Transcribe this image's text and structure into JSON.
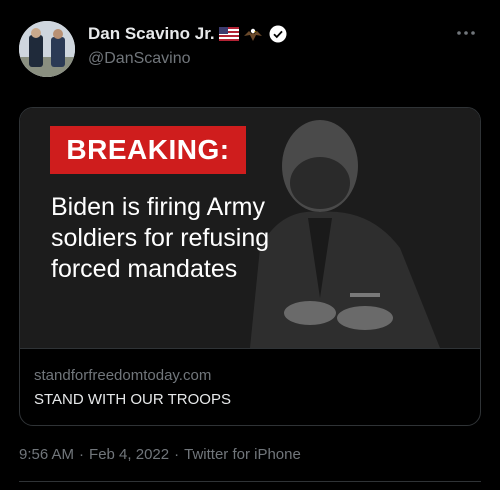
{
  "tweet": {
    "author": {
      "display_name": "Dan Scavino Jr.",
      "handle": "@DanScavino",
      "badges": [
        "us-flag-icon",
        "eagle-icon",
        "verified-icon"
      ]
    },
    "card": {
      "image": {
        "badge_text": "BREAKING:",
        "headline": "Biden is firing Army soldiers for refusing forced mandates"
      },
      "domain": "standforfreedomtoday.com",
      "title": "STAND WITH OUR TROOPS"
    },
    "meta": {
      "time": "9:56 AM",
      "separator": "·",
      "date": "Feb 4, 2022",
      "source": "Twitter for iPhone"
    }
  },
  "colors": {
    "background": "#000000",
    "text_primary": "#e7e9ea",
    "text_secondary": "#71767b",
    "border": "#2f3336",
    "badge_red": "#cf1d1d"
  }
}
